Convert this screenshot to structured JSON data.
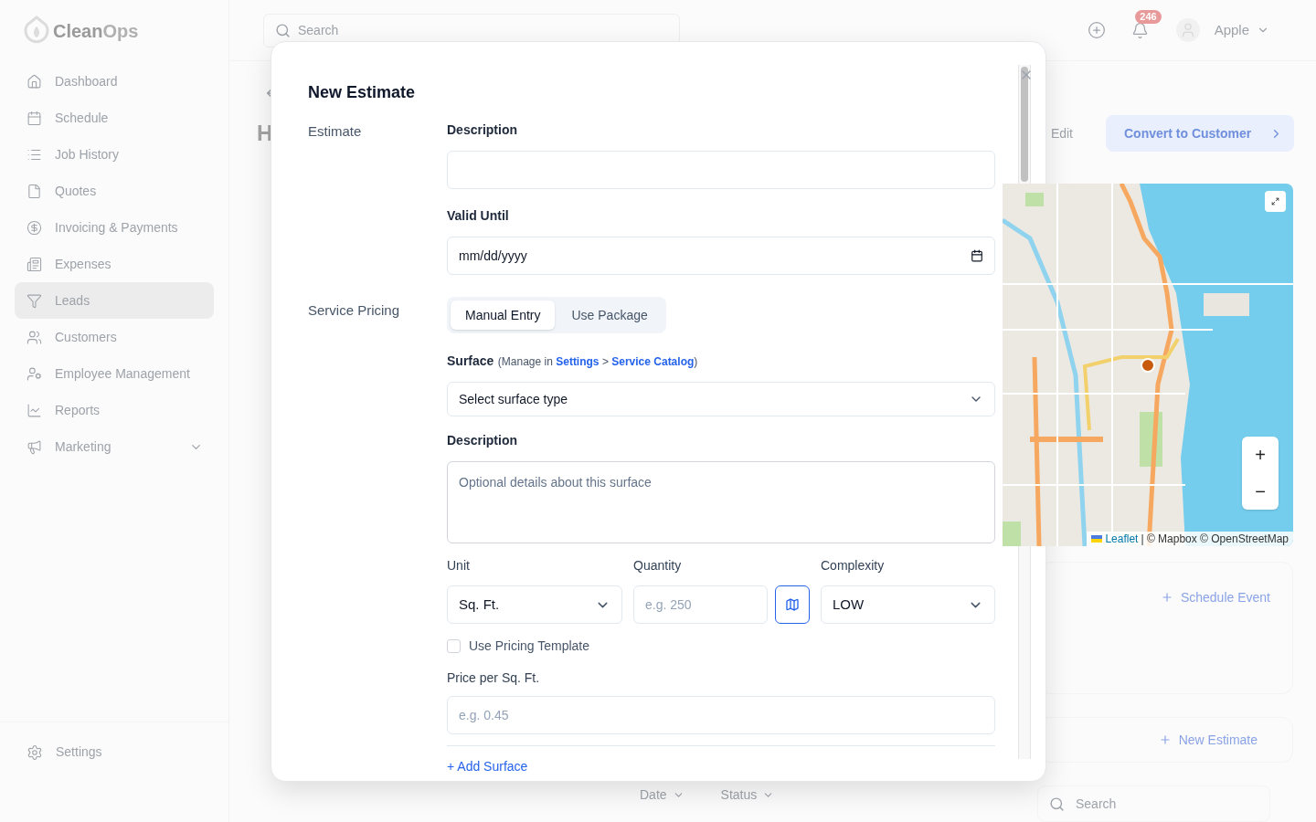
{
  "app": {
    "logo": {
      "first": "Clean",
      "second": "Ops"
    },
    "nav": [
      {
        "label": "Dashboard",
        "kind": "link",
        "selected": false
      },
      {
        "label": "Schedule",
        "kind": "link",
        "selected": false
      },
      {
        "label": "Job History",
        "kind": "link",
        "selected": false
      },
      {
        "label": "Quotes",
        "kind": "link",
        "selected": false
      },
      {
        "label": "Invoicing & Payments",
        "kind": "link",
        "selected": false
      },
      {
        "label": "Expenses",
        "kind": "link",
        "selected": false
      },
      {
        "label": "Leads",
        "kind": "link",
        "selected": true
      },
      {
        "label": "Customers",
        "kind": "link",
        "selected": false
      },
      {
        "label": "Employee Management",
        "kind": "link",
        "selected": false
      },
      {
        "label": "Reports",
        "kind": "link",
        "selected": false
      },
      {
        "label": "Marketing",
        "kind": "group",
        "selected": false
      }
    ],
    "settings": "Settings"
  },
  "topbar": {
    "search": {
      "placeholder": "Search"
    },
    "notifications": "246",
    "user": "Apple"
  },
  "page": {
    "heading": "H",
    "edit": "Edit",
    "convert": "Convert to Customer",
    "schedule_event": "Schedule Event",
    "new_estimate": "New Estimate",
    "filters": [
      "Date",
      "Status"
    ],
    "search": {
      "placeholder": "Search"
    }
  },
  "modal": {
    "title": "New Estimate",
    "estimate": {
      "label": "Estimate",
      "description": {
        "label": "Description"
      },
      "valid_until": {
        "label": "Valid Until",
        "value": "mm/dd/yyyy"
      }
    },
    "service_pricing": {
      "label": "Service Pricing",
      "tabs": [
        {
          "label": "Manual Entry",
          "selected": true
        },
        {
          "label": "Use Package",
          "selected": false
        }
      ],
      "surface": {
        "label": "Surface",
        "note_start": "(Manage in",
        "links": [
          "Settings",
          "Service Catalog"
        ],
        "separator": ">",
        "note_end": ")",
        "value": "Select surface type"
      },
      "description": {
        "label": "Description",
        "placeholder": "Optional details about this surface"
      },
      "unit": {
        "label": "Unit",
        "value": "Sq. Ft."
      },
      "quantity": {
        "label": "Quantity",
        "placeholder": "e.g. 250"
      },
      "complexity": {
        "label": "Complexity",
        "value": "LOW"
      },
      "pricing_template": {
        "label": "Use Pricing Template",
        "checked": false
      },
      "price": {
        "label": "Price per Sq. Ft.",
        "placeholder": "e.g. 0.45"
      },
      "add_surface": "+ Add Surface"
    }
  },
  "map": {
    "zoom_in": "+",
    "zoom_out": "−",
    "attribution": {
      "link": "Leaflet",
      "text": "| © Mapbox © OpenStreetMap"
    }
  }
}
